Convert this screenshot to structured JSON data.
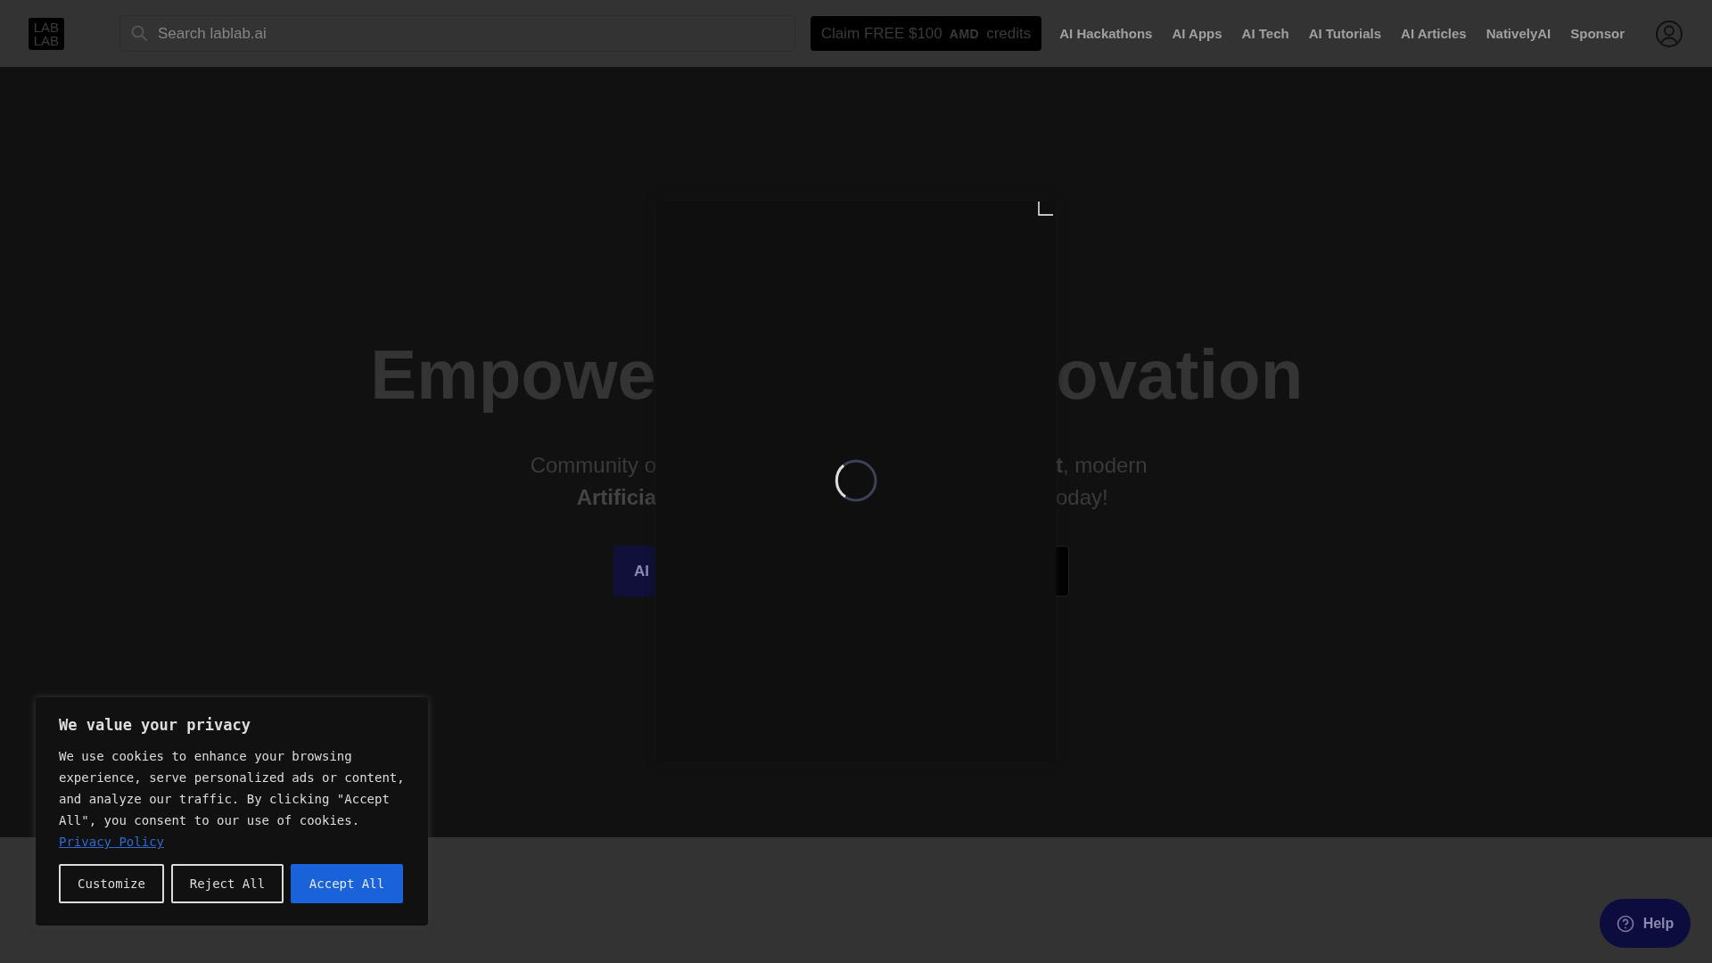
{
  "header": {
    "logo": [
      "LAB",
      "LAB"
    ],
    "search": {
      "placeholder": "Search lablab.ai"
    },
    "promo": {
      "before": "Claim FREE $100",
      "brand": "AMD",
      "after": "credits"
    },
    "nav": [
      "AI Hackathons",
      "AI Apps",
      "AI Tech",
      "AI Tutorials",
      "AI Articles",
      "NativelyAI",
      "Sponsor"
    ]
  },
  "hero": {
    "left": {
      "heading": "Empowe",
      "lines": [
        "Community o",
        "Artificia"
      ],
      "button": "AI"
    },
    "right": {
      "heading": "ovation",
      "lines": [
        "**t**, modern",
        "oday!"
      ]
    }
  },
  "loading": {
    "kind": "spinner"
  },
  "cookie_banner": {
    "title": "We value your privacy",
    "text": "We use cookies to enhance your browsing experience, serve personalized ads or content, and analyze our traffic. By clicking \"Accept All\", you consent to our use of cookies.",
    "link": "Privacy Policy",
    "buttons": [
      {
        "label": "Customize",
        "kind": "outline"
      },
      {
        "label": "Reject All",
        "kind": "outline"
      },
      {
        "label": "Accept All",
        "kind": "primary"
      }
    ]
  },
  "help": {
    "label": "Help"
  }
}
